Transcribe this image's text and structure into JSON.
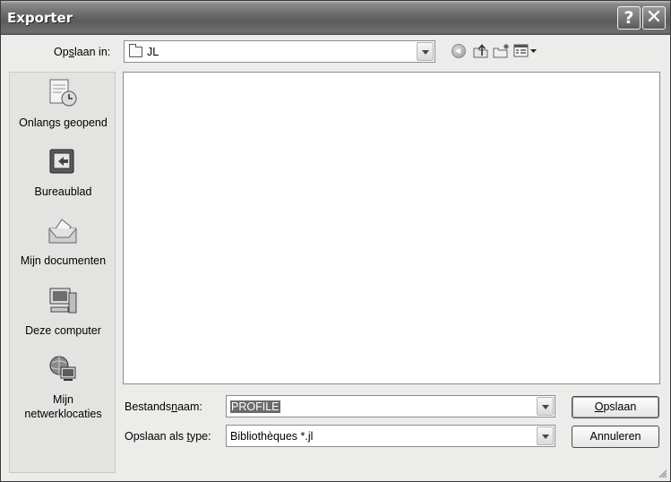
{
  "window": {
    "title": "Exporter"
  },
  "titlebar": {
    "help_glyph": "?",
    "close_glyph": "✕"
  },
  "toolbar": {
    "lookin_label_pre": "Op",
    "lookin_label_u": "s",
    "lookin_label_post": "laan in:",
    "lookin_value": "JL",
    "icons": [
      "back-icon",
      "up-folder-icon",
      "new-folder-icon",
      "views-menu-icon"
    ]
  },
  "places": [
    {
      "label": "Onlangs geopend",
      "icon": "recent-documents-icon"
    },
    {
      "label": "Bureaublad",
      "icon": "desktop-icon"
    },
    {
      "label": "Mijn documenten",
      "icon": "my-documents-icon"
    },
    {
      "label": "Deze computer",
      "icon": "my-computer-icon"
    },
    {
      "label": "Mijn netwerklocaties",
      "label_line1": "Mijn",
      "label_line2": "netwerklocaties",
      "icon": "network-places-icon"
    }
  ],
  "filename": {
    "label_pre": "Bestands",
    "label_u": "n",
    "label_post": "aam:",
    "value": "PROFILE"
  },
  "filetype": {
    "label_pre": "Opslaan als ",
    "label_u": "t",
    "label_post": "ype:",
    "value": "Bibliothèques *.jl"
  },
  "buttons": {
    "save_u": "O",
    "save_rest": "pslaan",
    "cancel": "Annuleren"
  }
}
